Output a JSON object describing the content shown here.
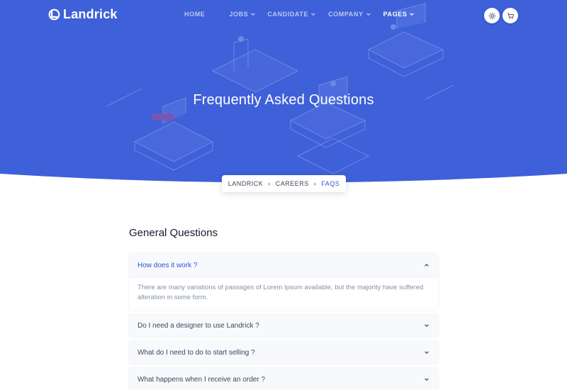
{
  "brand": {
    "name": "Landrick"
  },
  "nav": {
    "items": [
      {
        "id": "home",
        "label": "HOME",
        "has_dropdown": false,
        "active": false
      },
      {
        "id": "jobs",
        "label": "JOBS",
        "has_dropdown": true,
        "active": false
      },
      {
        "id": "candidate",
        "label": "CANDIDATE",
        "has_dropdown": true,
        "active": false
      },
      {
        "id": "company",
        "label": "COMPANY",
        "has_dropdown": true,
        "active": false
      },
      {
        "id": "pages",
        "label": "PAGES",
        "has_dropdown": true,
        "active": true
      }
    ],
    "icon_buttons": [
      "settings-icon",
      "cart-icon"
    ]
  },
  "hero": {
    "title": "Frequently Asked Questions"
  },
  "breadcrumb": {
    "items": [
      "LANDRICK",
      "CAREERS"
    ],
    "current": "FAQS"
  },
  "faq_section": {
    "title": "General Questions",
    "items": [
      {
        "question": "How does it work ?",
        "answer": "There are many variations of passages of Lorem Ipsum available, but the majority have suffered alteration in some form.",
        "open": true
      },
      {
        "question": "Do I need a designer to use Landrick ?",
        "open": false
      },
      {
        "question": "What do I need to do to start selling ?",
        "open": false
      },
      {
        "question": "What happens when I receive an order ?",
        "open": false
      }
    ]
  },
  "colors": {
    "primary": "#2f55d4",
    "hero_bg": "#3e60d8",
    "heading": "#161c2d",
    "muted": "#8492a6",
    "card_bg": "#f8f9fc"
  }
}
